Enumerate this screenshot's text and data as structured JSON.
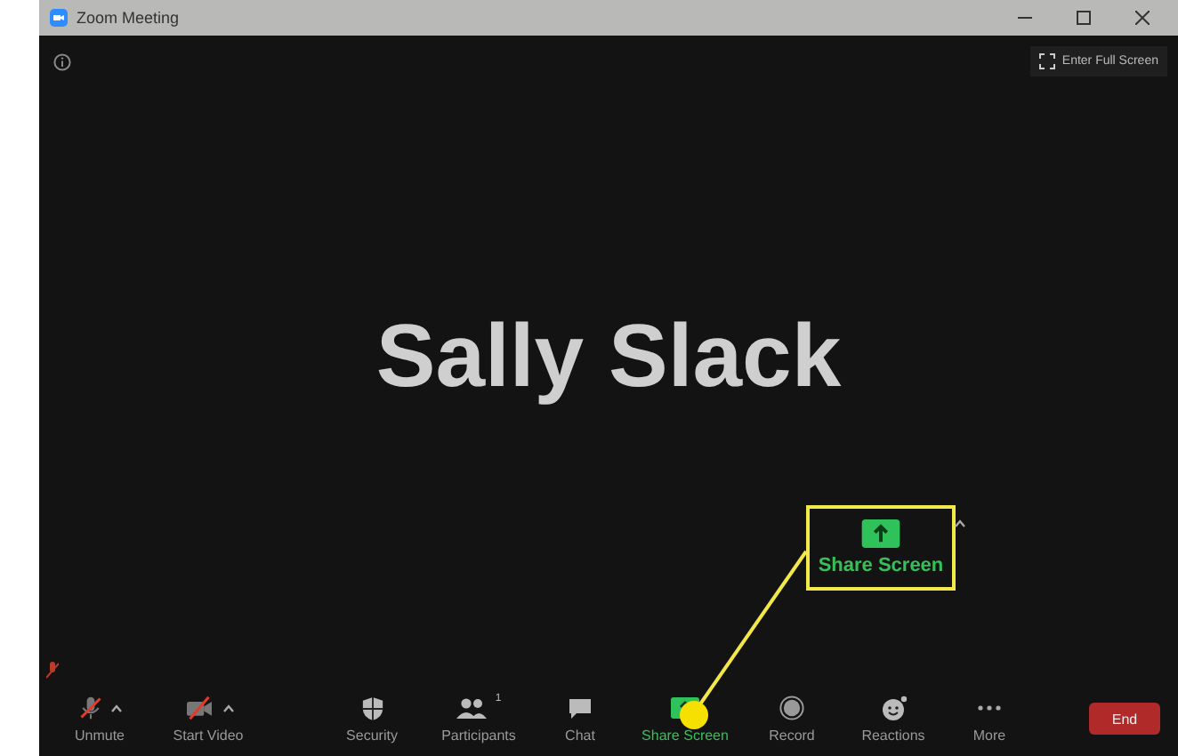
{
  "window": {
    "title": "Zoom Meeting"
  },
  "full_screen_button": {
    "label": "Enter Full Screen"
  },
  "participant_name": "Sally Slack",
  "callout": {
    "label": "Share Screen"
  },
  "toolbar": {
    "items": [
      {
        "kind": "mic",
        "label": "Unmute",
        "off": true,
        "caret": true
      },
      {
        "kind": "video",
        "label": "Start Video",
        "off": true,
        "caret": true
      },
      {
        "kind": "security",
        "label": "Security"
      },
      {
        "kind": "participants",
        "label": "Participants",
        "count": "1"
      },
      {
        "kind": "chat",
        "label": "Chat"
      },
      {
        "kind": "share",
        "label": "Share Screen",
        "active": true
      },
      {
        "kind": "record",
        "label": "Record"
      },
      {
        "kind": "reactions",
        "label": "Reactions"
      },
      {
        "kind": "more",
        "label": "More"
      }
    ],
    "end_button": "End"
  }
}
